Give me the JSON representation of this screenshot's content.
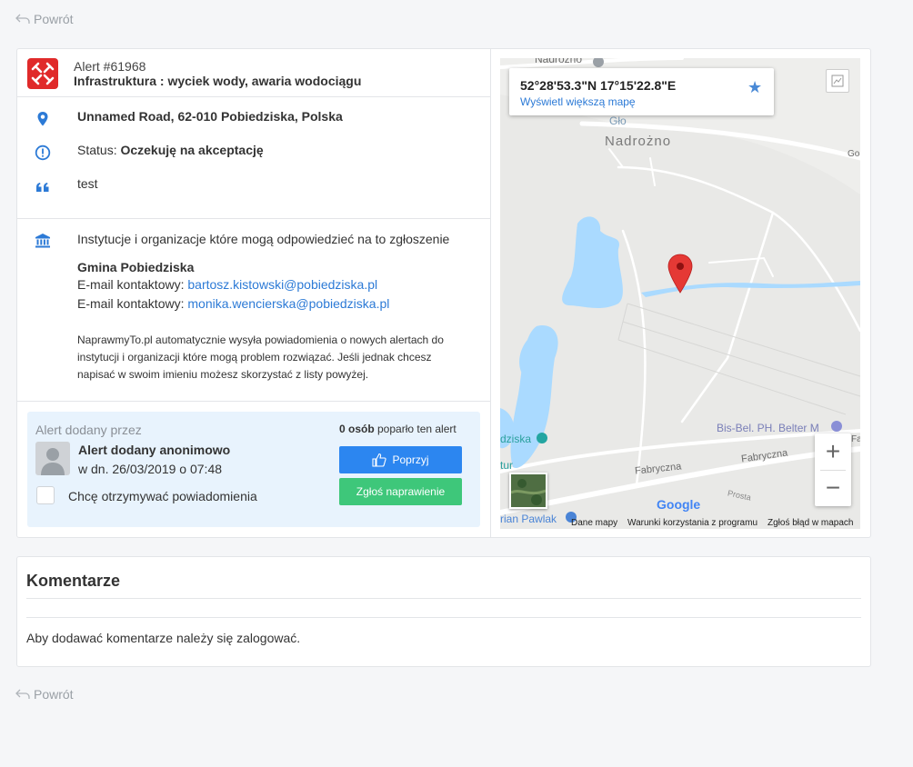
{
  "nav": {
    "back_label": "Powrót"
  },
  "alert": {
    "id_label": "Alert #61968",
    "category": "Infrastruktura : wyciek wody, awaria wodociągu",
    "address": "Unnamed Road, 62-010 Pobiedziska, Polska",
    "status_prefix": "Status: ",
    "status_value": "Oczekuję na akceptację",
    "description": "test"
  },
  "institutions": {
    "title": "Instytucje i organizacje które mogą odpowiedzieć na to zgłoszenie",
    "org_name": "Gmina Pobiedziska",
    "email_label": "E-mail kontaktowy: ",
    "emails": [
      "bartosz.kistowski@pobiedziska.pl",
      "monika.wencierska@pobiedziska.pl"
    ],
    "note": "NaprawmyTo.pl automatycznie wysyła powiadomienia o nowych alertach do instytucji i organizacji które mogą problem rozwiązać. Jeśli jednak chcesz napisać w swoim imieniu możesz skorzystać z listy powyżej."
  },
  "added_by": {
    "title": "Alert dodany przez",
    "name": "Alert dodany anonimowo",
    "date": "w dn. 26/03/2019 o 07:48",
    "notify_label": "Chcę otrzymywać powiadomienia",
    "support_count": "0 osób",
    "support_suffix": " poparło ten alert",
    "support_button": "Poprzyj",
    "fix_button": "Zgłoś naprawienie"
  },
  "map": {
    "coordinates": "52°28'53.3\"N 17°15'22.8\"E",
    "bigger_map_link": "Wyświetl większą mapę",
    "labels": {
      "nadrozno_top": "Nadrożno",
      "nadrozno": "Nadrożno",
      "glo": "Gło",
      "go": "Go",
      "bis_bel": "Bis-Bel. PH. Belter M",
      "fabryczna_1": "Fabryczna",
      "fabryczna_2": "Fabryczna",
      "prosta": "Prosta",
      "dziska": "dziska",
      "tur": "tur",
      "rian_pawlak": "rian Pawlak",
      "fa": "Fa"
    },
    "google": "Google",
    "footer": {
      "data": "Dane mapy",
      "terms": "Warunki korzystania z programu",
      "report": "Zgłoś błąd w mapach"
    },
    "zoom_in": "+",
    "zoom_out": "−",
    "colors": {
      "water": "#aadaff",
      "road": "#ffffff",
      "pin": "#e53935",
      "land": "#e9e9e7"
    }
  },
  "comments": {
    "title": "Komentarze",
    "login_text": "Aby dodawać komentarze należy się zalogować."
  }
}
